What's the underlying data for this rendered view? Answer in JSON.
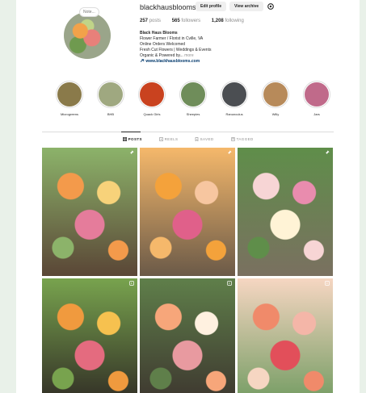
{
  "profile": {
    "username": "blackhausblooms",
    "edit_profile_label": "Edit profile",
    "view_archive_label": "View archive",
    "note_label": "Note...",
    "stats": {
      "posts_count": "257",
      "posts_label": "posts",
      "followers_count": "565",
      "followers_label": "followers",
      "following_count": "1,208",
      "following_label": "following"
    },
    "bio": {
      "name": "Black Haus Blooms",
      "line1": "Flower Farmer / Florist in Cville, VA",
      "line2": "Online Orders Welcomed",
      "line3": "Fresh Cut Flowers | Weddings & Events",
      "line4_text": "Organic & Powered by... ",
      "line4_more": "more",
      "link": "www.blackhausblooms.com"
    }
  },
  "highlights": [
    {
      "label": "Microgreens",
      "color": "#8a7a4a"
    },
    {
      "label": "BHB",
      "color": "#9fa880"
    },
    {
      "label": "Quack Girls",
      "color": "#c9421f"
    },
    {
      "label": "Sheepies",
      "color": "#6f8d5a"
    },
    {
      "label": "Ranunculus",
      "color": "#4b4e52"
    },
    {
      "label": "Willy",
      "color": "#b78a5a"
    },
    {
      "label": "Jars",
      "color": "#c06a8a"
    }
  ],
  "tabs": [
    {
      "label": "POSTS",
      "icon": "grid-icon",
      "active": true
    },
    {
      "label": "REELS",
      "icon": "reels-icon",
      "active": false
    },
    {
      "label": "SAVED",
      "icon": "bookmark-icon",
      "active": false
    },
    {
      "label": "TAGGED",
      "icon": "tag-icon",
      "active": false
    }
  ],
  "posts": [
    {
      "pinned": true,
      "colors": [
        "#f39a4b",
        "#f7d27a",
        "#e57c9b",
        "#8cb36a",
        "#5a4636"
      ]
    },
    {
      "pinned": true,
      "colors": [
        "#f4a23b",
        "#f7c6a0",
        "#e0608a",
        "#f5b86b",
        "#6b5a48"
      ]
    },
    {
      "pinned": true,
      "colors": [
        "#f7d5d5",
        "#e98cae",
        "#fff3d6",
        "#5f8e4a",
        "#7a7060"
      ]
    },
    {
      "pinned": false,
      "colors": [
        "#f09a3e",
        "#f6c14f",
        "#e46b7f",
        "#78a34e",
        "#2f2a24"
      ]
    },
    {
      "pinned": false,
      "colors": [
        "#f7a67a",
        "#fff1e0",
        "#e89aa0",
        "#5f7f4a",
        "#3c342e"
      ]
    },
    {
      "pinned": false,
      "colors": [
        "#f08a6a",
        "#f4b6a8",
        "#e24f5a",
        "#f6d6c2",
        "#6f9a5f"
      ]
    }
  ]
}
